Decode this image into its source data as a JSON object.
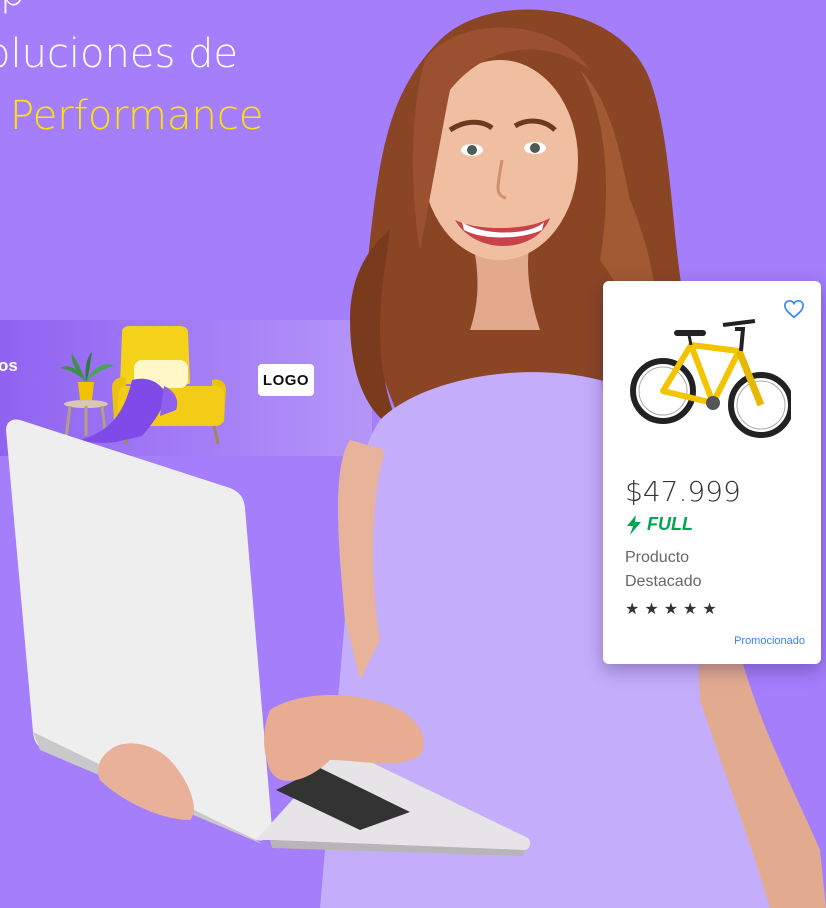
{
  "headline": {
    "line1": "p",
    "line2": "oluciones de",
    "line3": "Performance",
    "accent_color": "#ffe600"
  },
  "banner": {
    "text": "os",
    "logo_label": "LOGO",
    "image_icon": "armchair-scene"
  },
  "product": {
    "price": "$47.999",
    "shipping_badge": "FULL",
    "name": "Producto Destacado",
    "rating_stars": 5,
    "rating_display": "★★★★★",
    "promoted_label": "Promocionado",
    "favorite_icon": "heart-icon",
    "image_icon": "bicycle",
    "badge_color": "#00a650",
    "promoted_color": "#3483fa"
  },
  "colors": {
    "background": "#a47efb"
  }
}
